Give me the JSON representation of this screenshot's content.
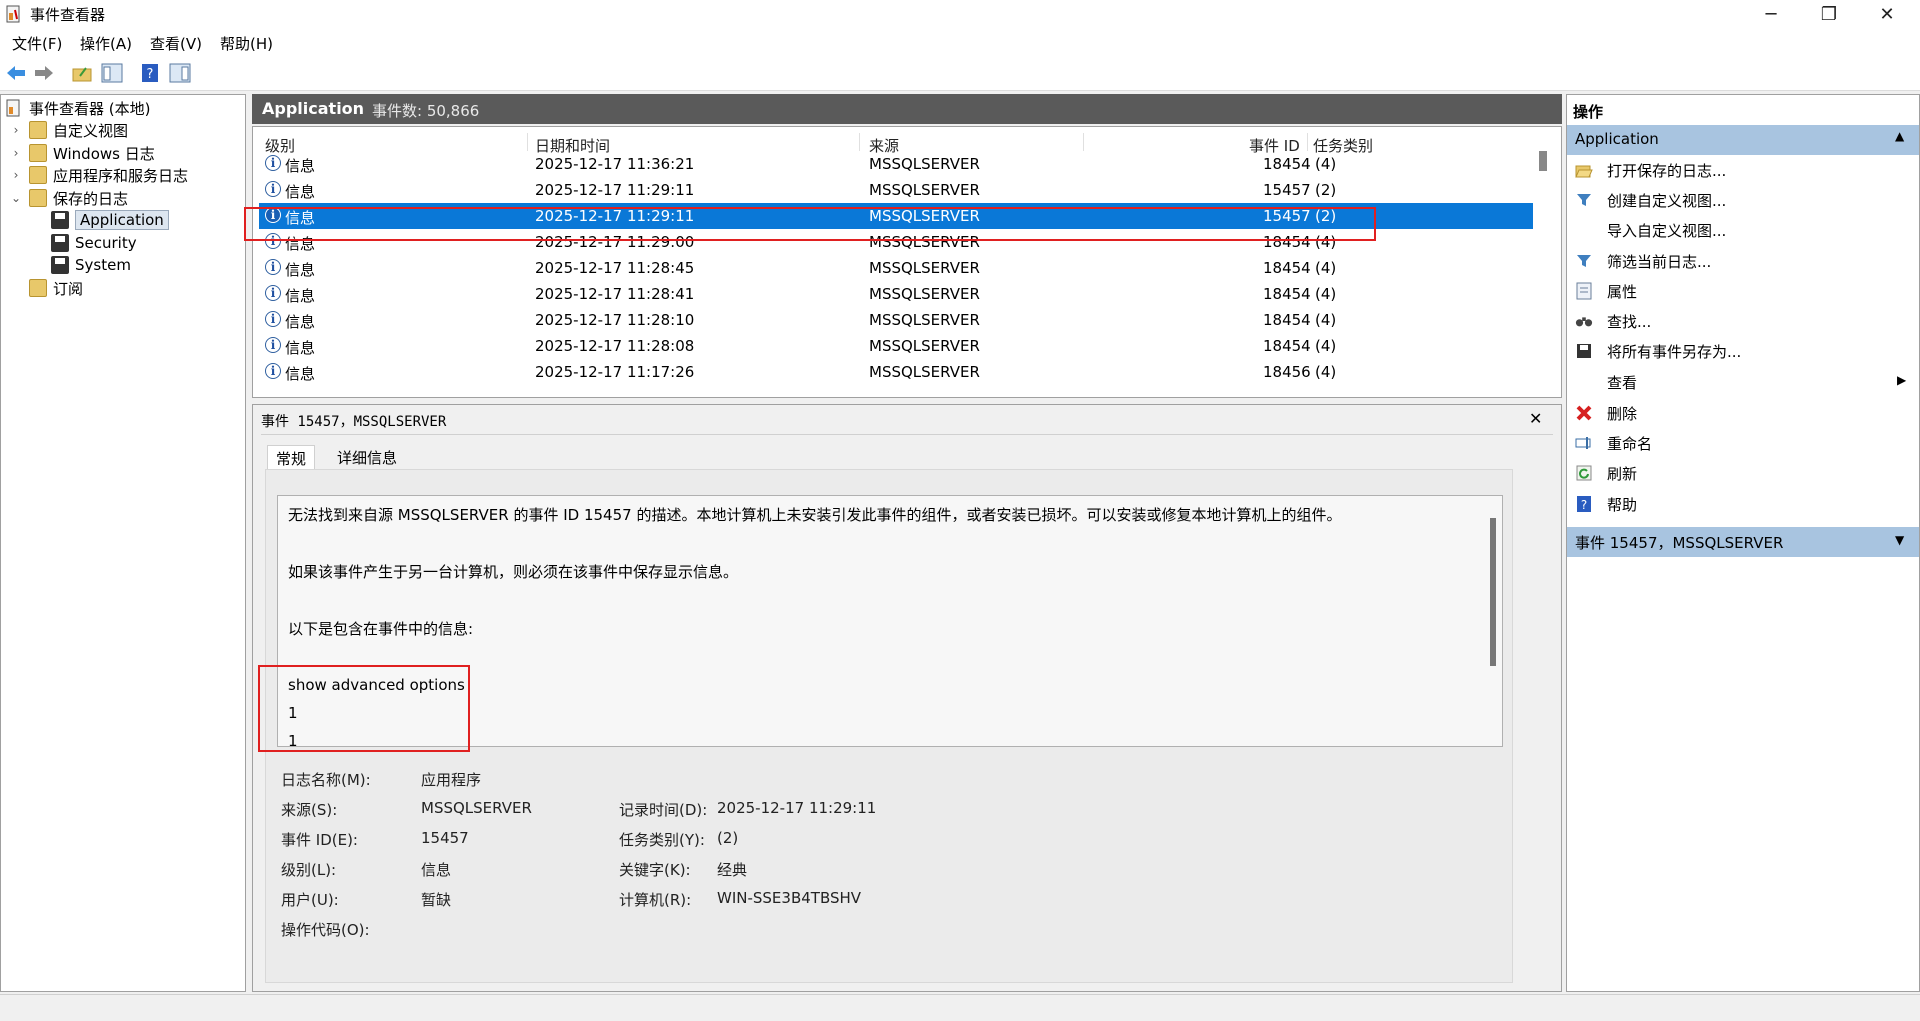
{
  "window": {
    "title": "事件查看器",
    "minimize": "─",
    "maximize": "❐",
    "close": "✕"
  },
  "menu": [
    "文件(F)",
    "操作(A)",
    "查看(V)",
    "帮助(H)"
  ],
  "tree": {
    "root": "事件查看器 (本地)",
    "custom_views": "自定义视图",
    "windows_logs": "Windows 日志",
    "app_service_logs": "应用程序和服务日志",
    "saved_logs": "保存的日志",
    "saved_children": [
      "Application",
      "Security",
      "System"
    ],
    "subscriptions": "订阅"
  },
  "center": {
    "log_name": "Application",
    "event_count": "事件数: 50,866"
  },
  "list": {
    "columns": [
      "级别",
      "日期和时间",
      "来源",
      "事件 ID",
      "任务类别"
    ],
    "rows": [
      {
        "level": "信息",
        "datetime": "2025-12-17 11:36:21",
        "source": "MSSQLSERVER",
        "id": "18454",
        "task": "(4)"
      },
      {
        "level": "信息",
        "datetime": "2025-12-17 11:29:11",
        "source": "MSSQLSERVER",
        "id": "15457",
        "task": "(2)"
      },
      {
        "level": "信息",
        "datetime": "2025-12-17 11:29:11",
        "source": "MSSQLSERVER",
        "id": "15457",
        "task": "(2)"
      },
      {
        "level": "信息",
        "datetime": "2025-12-17 11:29:00",
        "source": "MSSQLSERVER",
        "id": "18454",
        "task": "(4)"
      },
      {
        "level": "信息",
        "datetime": "2025-12-17 11:28:45",
        "source": "MSSQLSERVER",
        "id": "18454",
        "task": "(4)"
      },
      {
        "level": "信息",
        "datetime": "2025-12-17 11:28:41",
        "source": "MSSQLSERVER",
        "id": "18454",
        "task": "(4)"
      },
      {
        "level": "信息",
        "datetime": "2025-12-17 11:28:10",
        "source": "MSSQLSERVER",
        "id": "18454",
        "task": "(4)"
      },
      {
        "level": "信息",
        "datetime": "2025-12-17 11:28:08",
        "source": "MSSQLSERVER",
        "id": "18454",
        "task": "(4)"
      },
      {
        "level": "信息",
        "datetime": "2025-12-17 11:17:26",
        "source": "MSSQLSERVER",
        "id": "18456",
        "task": "(4)"
      }
    ],
    "selected_index": 2
  },
  "detail": {
    "title": "事件 15457，MSSQLSERVER",
    "close": "✕",
    "tabs": [
      "常规",
      "详细信息"
    ],
    "description": [
      "无法找到来自源 MSSQLSERVER 的事件 ID 15457 的描述。本地计算机上未安装引发此事件的组件，或者安装已损坏。可以安装或修复本地计算机上的组件。",
      "如果该事件产生于另一台计算机，则必须在该事件中保存显示信息。",
      "以下是包含在事件中的信息:",
      "show advanced options",
      "1",
      "1"
    ],
    "props": {
      "log_name_label": "日志名称(M):",
      "log_name": "应用程序",
      "source_label": "来源(S):",
      "source": "MSSQLSERVER",
      "logged_label": "记录时间(D):",
      "logged": "2025-12-17 11:29:11",
      "event_id_label": "事件 ID(E):",
      "event_id": "15457",
      "task_label": "任务类别(Y):",
      "task": "(2)",
      "level_label": "级别(L):",
      "level": "信息",
      "keywords_label": "关键字(K):",
      "keywords": "经典",
      "user_label": "用户(U):",
      "user": "暂缺",
      "computer_label": "计算机(R):",
      "computer": "WIN-SSE3B4TBSHV",
      "opcode_label": "操作代码(O):"
    }
  },
  "actions": {
    "title": "操作",
    "section1": "Application",
    "items1": [
      {
        "icon": "open-folder-icon",
        "label": "打开保存的日志..."
      },
      {
        "icon": "filter-icon",
        "label": "创建自定义视图..."
      },
      {
        "icon": "none",
        "label": "导入自定义视图..."
      },
      {
        "icon": "filter-icon",
        "label": "筛选当前日志..."
      },
      {
        "icon": "properties-icon",
        "label": "属性"
      },
      {
        "icon": "binoculars-icon",
        "label": "查找..."
      },
      {
        "icon": "save-icon",
        "label": "将所有事件另存为..."
      },
      {
        "icon": "none",
        "label": "查看"
      },
      {
        "icon": "delete-icon",
        "label": "删除"
      },
      {
        "icon": "rename-icon",
        "label": "重命名"
      },
      {
        "icon": "refresh-icon",
        "label": "刷新"
      },
      {
        "icon": "help-icon",
        "label": "帮助"
      }
    ],
    "section2": "事件 15457，MSSQLSERVER"
  }
}
